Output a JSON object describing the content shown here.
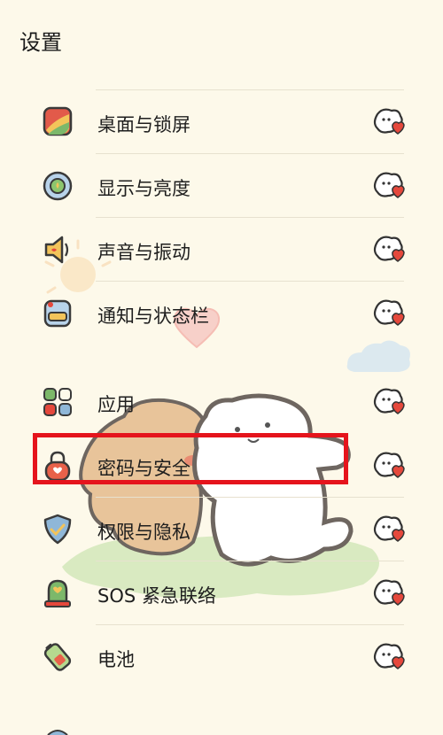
{
  "header": {
    "title": "设置"
  },
  "settings": [
    {
      "label": "桌面与锁屏",
      "icon": "wallpaper-icon"
    },
    {
      "label": "显示与亮度",
      "icon": "display-icon"
    },
    {
      "label": "声音与振动",
      "icon": "sound-icon"
    },
    {
      "label": "通知与状态栏",
      "icon": "notification-icon"
    },
    {
      "label": "应用",
      "icon": "apps-icon"
    },
    {
      "label": "密码与安全",
      "icon": "lock-icon"
    },
    {
      "label": "权限与隐私",
      "icon": "privacy-shield-icon"
    },
    {
      "label": "SOS 紧急联络",
      "icon": "sos-bell-icon"
    },
    {
      "label": "电池",
      "icon": "battery-icon"
    }
  ],
  "highlighted_item": "密码与安全",
  "colors": {
    "background": "#fdf9ea",
    "highlight": "#e5141c",
    "divider": "#e7e1cf"
  }
}
